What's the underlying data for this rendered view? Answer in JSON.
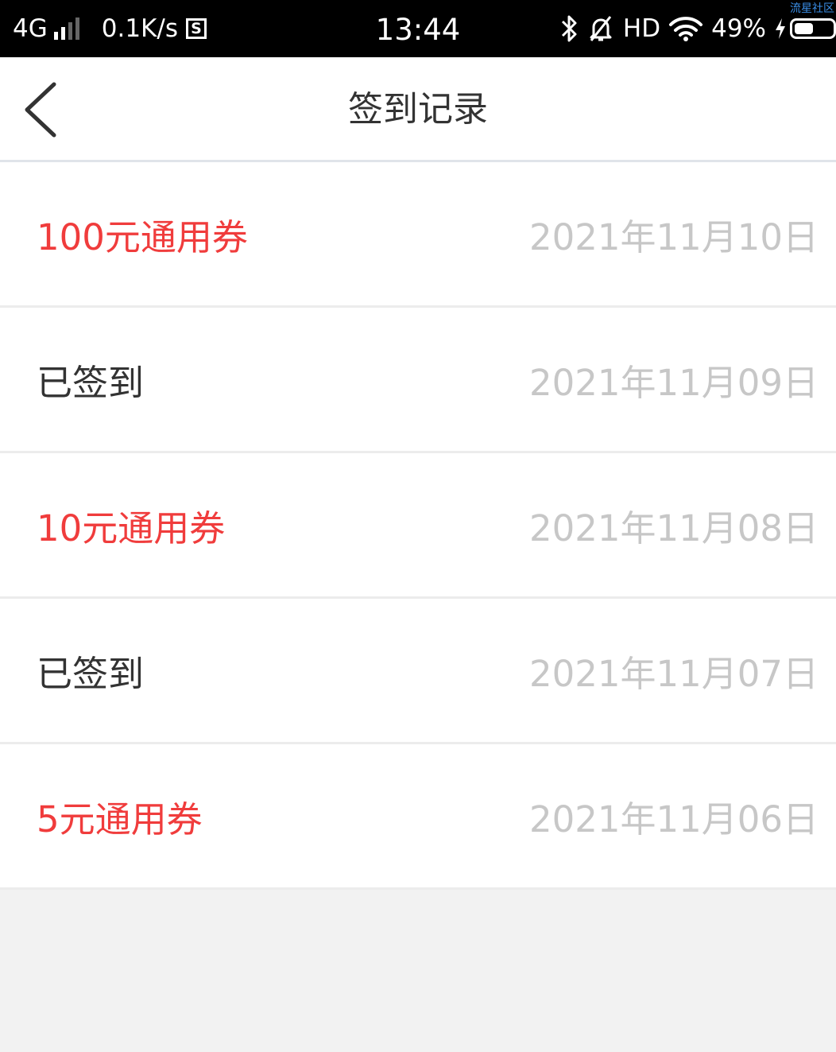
{
  "status_bar": {
    "network": "4G",
    "speed": "0.1K/s",
    "s_icon_letter": "S",
    "time": "13:44",
    "hd": "HD",
    "battery_percent": "49%",
    "battery_level": 0.49,
    "watermark": "流星社区"
  },
  "header": {
    "title": "签到记录",
    "back_icon": "chevron-left-icon"
  },
  "records": [
    {
      "reward": "100元通用券",
      "date": "2021年11月10日",
      "is_coupon": true
    },
    {
      "reward": "已签到",
      "date": "2021年11月09日",
      "is_coupon": false
    },
    {
      "reward": "10元通用券",
      "date": "2021年11月08日",
      "is_coupon": true
    },
    {
      "reward": "已签到",
      "date": "2021年11月07日",
      "is_coupon": false
    },
    {
      "reward": "5元通用券",
      "date": "2021年11月06日",
      "is_coupon": true
    }
  ],
  "colors": {
    "coupon": "#f03c3c",
    "checked_in": "#333333",
    "date": "#c7c7c7",
    "background": "#f2f2f2"
  }
}
